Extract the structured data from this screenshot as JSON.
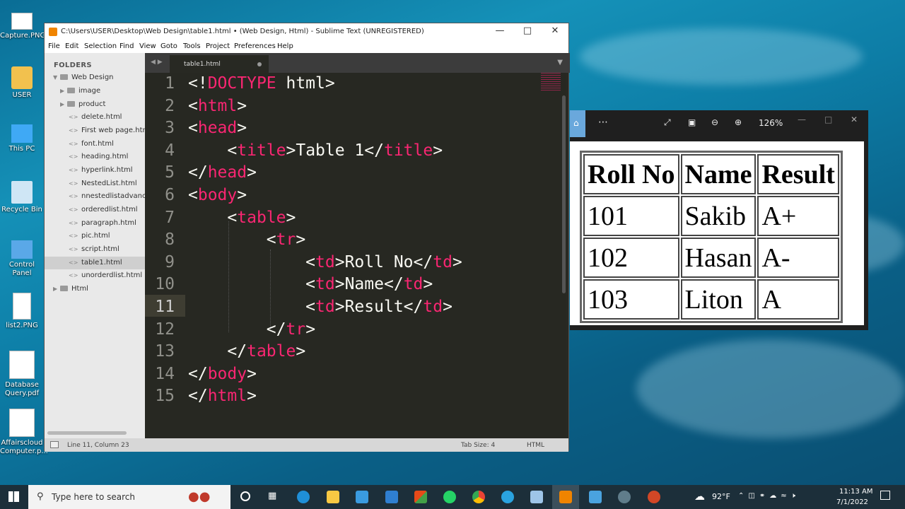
{
  "desktop": {
    "icons": [
      {
        "label": "Capture.PNG",
        "icon": "image-file-icon"
      },
      {
        "label": "USER",
        "icon": "user-folder-icon"
      },
      {
        "label": "This PC",
        "icon": "computer-icon"
      },
      {
        "label": "Recycle Bin",
        "icon": "recycle-bin-icon"
      },
      {
        "label": "Control Panel",
        "icon": "control-panel-icon"
      },
      {
        "label": "list2.PNG",
        "icon": "image-file-icon"
      },
      {
        "label": "Database Query.pdf",
        "icon": "pdf-file-icon"
      },
      {
        "label": "Affairscloud Computer.p...",
        "icon": "pdf-file-icon"
      }
    ]
  },
  "sublime": {
    "title": "C:\\Users\\USER\\Desktop\\Web Design\\table1.html • (Web Design, Html) - Sublime Text (UNREGISTERED)",
    "menu": [
      "File",
      "Edit",
      "Selection",
      "Find",
      "View",
      "Goto",
      "Tools",
      "Project",
      "Preferences",
      "Help"
    ],
    "sidebar": {
      "header": "FOLDERS",
      "root": "Web Design",
      "items": [
        {
          "label": "image",
          "type": "folder"
        },
        {
          "label": "product",
          "type": "folder"
        },
        {
          "label": "delete.html",
          "type": "file"
        },
        {
          "label": "First web page.html",
          "type": "file"
        },
        {
          "label": "font.html",
          "type": "file"
        },
        {
          "label": "heading.html",
          "type": "file"
        },
        {
          "label": "hyperlink.html",
          "type": "file"
        },
        {
          "label": "NestedList.html",
          "type": "file"
        },
        {
          "label": "nnestedlistadvance.h",
          "type": "file"
        },
        {
          "label": "orderedlist.html",
          "type": "file"
        },
        {
          "label": "paragraph.html",
          "type": "file"
        },
        {
          "label": "pic.html",
          "type": "file"
        },
        {
          "label": "script.html",
          "type": "file"
        },
        {
          "label": "table1.html",
          "type": "file",
          "selected": true
        },
        {
          "label": "unorderdlist.html",
          "type": "file"
        }
      ],
      "second_root": "Html"
    },
    "tab": "table1.html",
    "code": [
      "<!DOCTYPE html>",
      "<html>",
      "<head>",
      "    <title>Table 1</title>",
      "</head>",
      "<body>",
      "    <table>",
      "        <tr>",
      "            <td>Roll No</td>",
      "            <td>Name</td>",
      "            <td>Result</td>",
      "        </tr>",
      "    </table>",
      "</body>",
      "</html>"
    ],
    "status": {
      "position": "Line 11, Column 23",
      "tab_size": "Tab Size: 4",
      "syntax": "HTML"
    }
  },
  "viewer": {
    "zoom": "126%",
    "table": {
      "headers": [
        "Roll No",
        "Name",
        "Result"
      ],
      "rows": [
        [
          "101",
          "Sakib",
          "A+"
        ],
        [
          "102",
          "Hasan",
          "A-"
        ],
        [
          "103",
          "Liton",
          "A"
        ]
      ]
    }
  },
  "taskbar": {
    "search_placeholder": "Type here to search",
    "temperature": "92°F",
    "time": "11:13 AM",
    "date": "7/1/2022"
  },
  "colors": {
    "tag": "#f92672",
    "editor_bg": "#272822",
    "accent": "#6aa8dc"
  }
}
